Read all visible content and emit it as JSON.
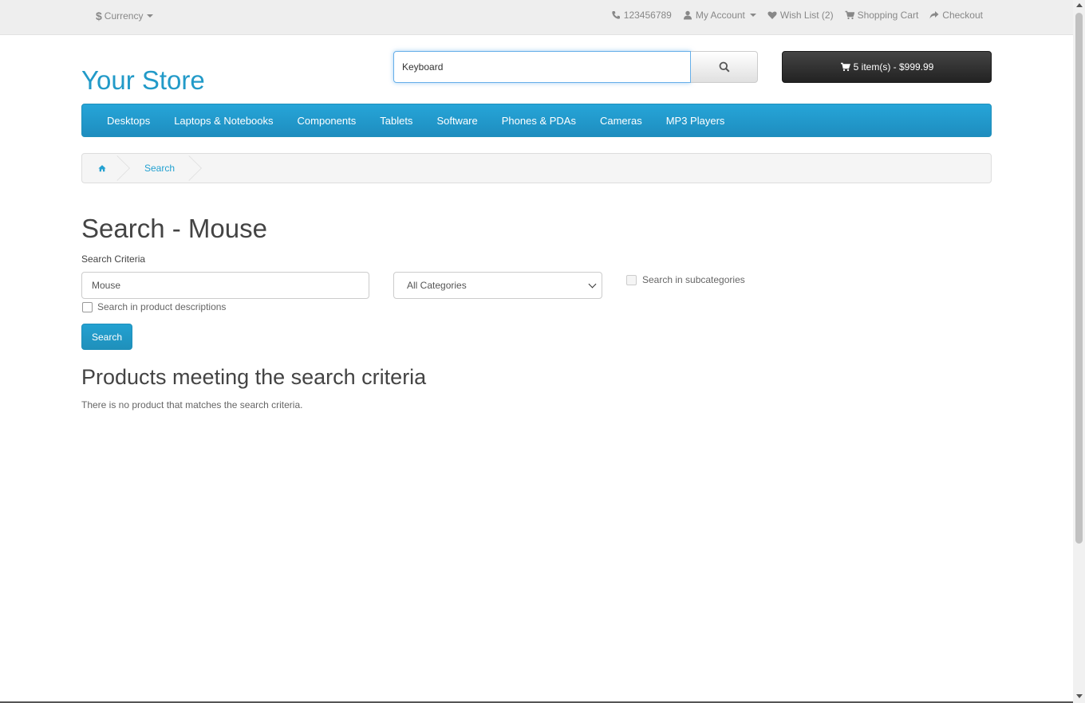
{
  "topbar": {
    "currency_symbol": "$",
    "currency_label": "Currency",
    "phone": "123456789",
    "my_account": "My Account",
    "wish_list": "Wish List (2)",
    "shopping_cart": "Shopping Cart",
    "checkout": "Checkout"
  },
  "header": {
    "logo": "Your Store",
    "search_value": "Keyboard",
    "cart_summary": "5 item(s) - $999.99"
  },
  "menu": {
    "items": [
      "Desktops",
      "Laptops & Notebooks",
      "Components",
      "Tablets",
      "Software",
      "Phones & PDAs",
      "Cameras",
      "MP3 Players"
    ]
  },
  "breadcrumb": {
    "items": [
      "Search"
    ]
  },
  "content": {
    "page_title": "Search - Mouse",
    "criteria_label": "Search Criteria",
    "keyword_value": "Mouse",
    "category_selected": "All Categories",
    "subcategories_label": "Search in subcategories",
    "descriptions_label": "Search in product descriptions",
    "search_button": "Search",
    "results_heading": "Products meeting the search criteria",
    "no_results": "There is no product that matches the search criteria."
  },
  "colors": {
    "accent": "#229ac8",
    "menu_bg": "#229ac8",
    "cart_bg": "#303030"
  },
  "icons": [
    "dollar-icon",
    "phone-icon",
    "user-icon",
    "heart-icon",
    "cart-icon",
    "share-icon",
    "search-icon",
    "home-icon"
  ]
}
